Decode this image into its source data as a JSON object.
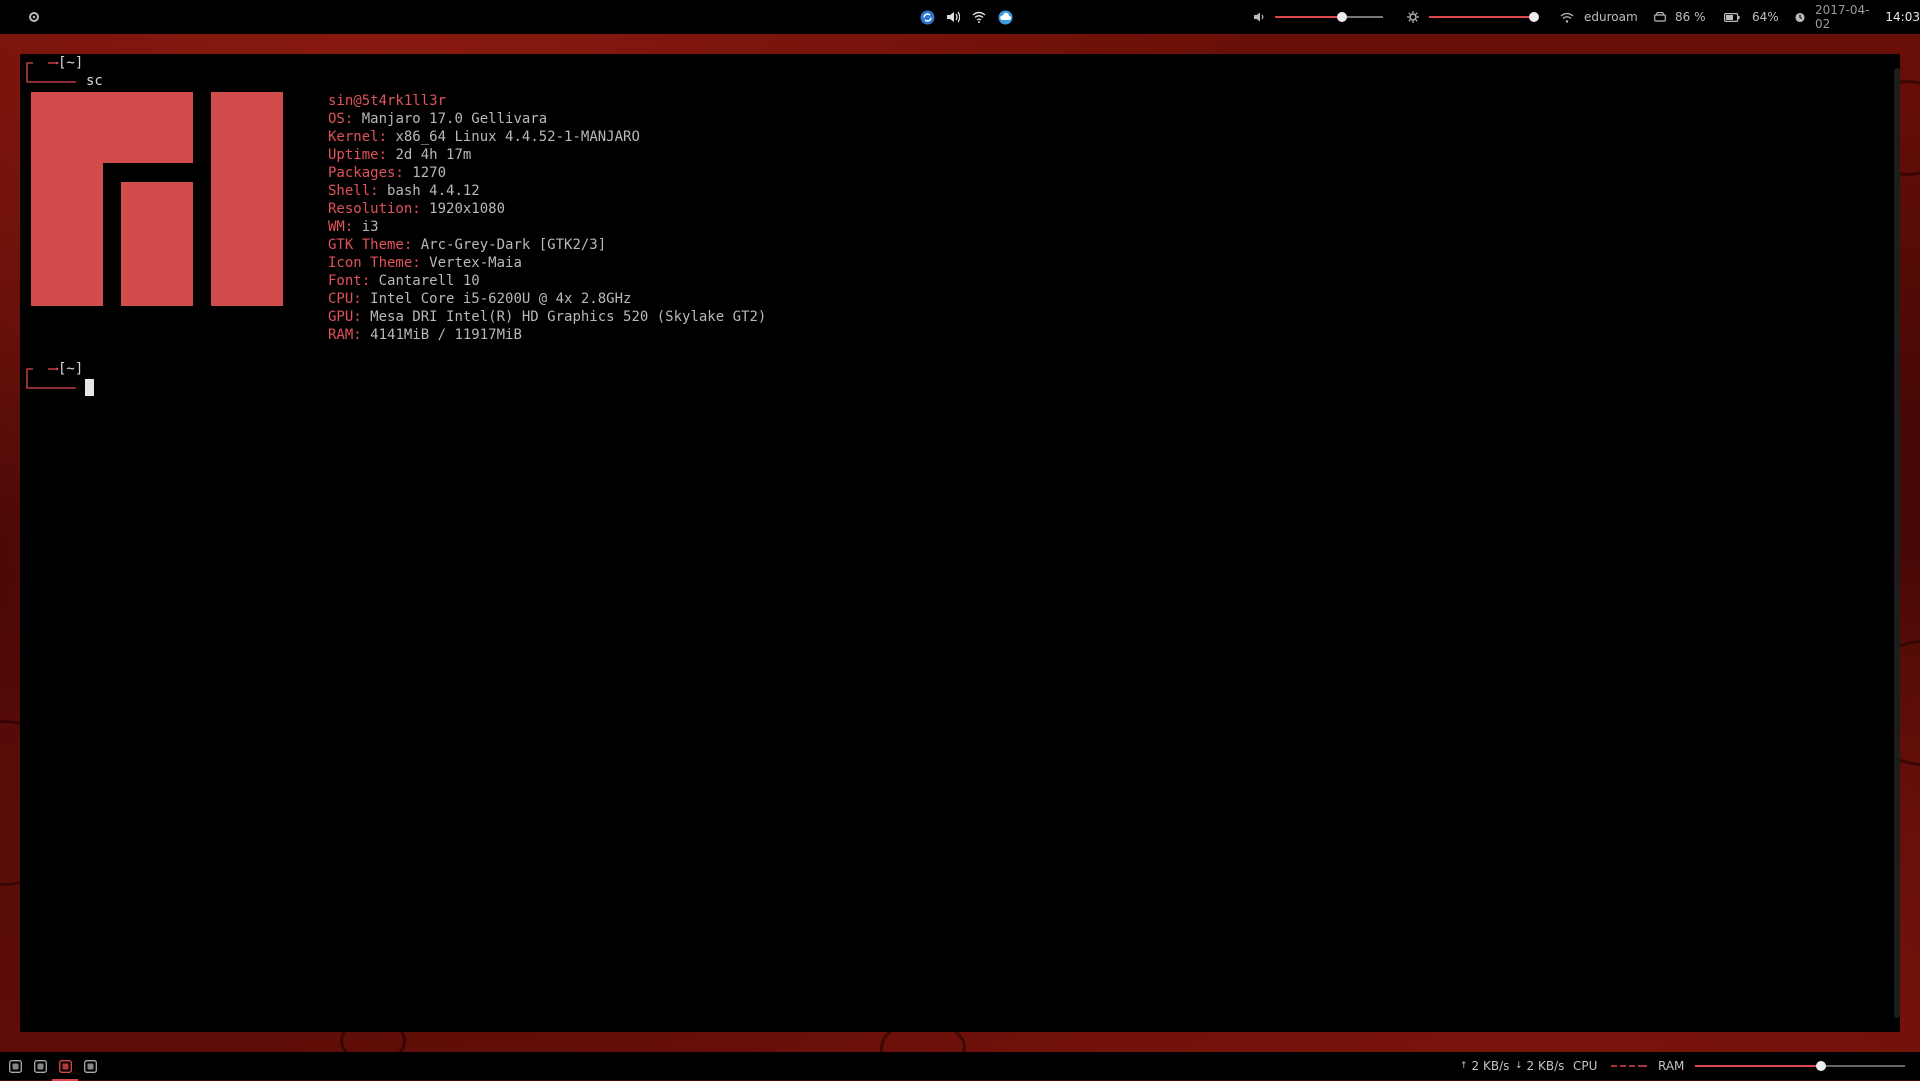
{
  "topbar": {
    "network_name": "eduroam",
    "disk_usage": "86 %",
    "battery": "64%",
    "date": "2017-04-02",
    "time": "14:03",
    "volume_level": 0.62,
    "brightness_level": 1.0,
    "accent_color": "#e0474c"
  },
  "terminal": {
    "prompt_dir": "[~]",
    "command": "sc",
    "user_host": "sin@5t4rk1ll3r",
    "info": [
      {
        "key": "OS:",
        "value": "Manjaro 17.0 Gellivara"
      },
      {
        "key": "Kernel:",
        "value": "x86_64 Linux 4.4.52-1-MANJARO"
      },
      {
        "key": "Uptime:",
        "value": "2d 4h 17m"
      },
      {
        "key": "Packages:",
        "value": "1270"
      },
      {
        "key": "Shell:",
        "value": "bash 4.4.12"
      },
      {
        "key": "Resolution:",
        "value": "1920x1080"
      },
      {
        "key": "WM:",
        "value": "i3"
      },
      {
        "key": "GTK Theme:",
        "value": "Arc-Grey-Dark [GTK2/3]"
      },
      {
        "key": "Icon Theme:",
        "value": "Vertex-Maia"
      },
      {
        "key": "Font:",
        "value": "Cantarell 10"
      },
      {
        "key": "CPU:",
        "value": "Intel Core i5-6200U @ 4x 2.8GHz"
      },
      {
        "key": "GPU:",
        "value": "Mesa DRI Intel(R) HD Graphics 520 (Skylake GT2)"
      },
      {
        "key": "RAM:",
        "value": "4141MiB / 11917MiB"
      }
    ],
    "logo_color": "#d24c4c"
  },
  "bottombar": {
    "upload": "2 KB/s",
    "download": "2 KB/s",
    "cpu_label": "CPU",
    "ram_label": "RAM",
    "ram_level": 0.6,
    "workspaces": [
      "1",
      "2",
      "3",
      "4"
    ],
    "active_workspace": 3
  }
}
